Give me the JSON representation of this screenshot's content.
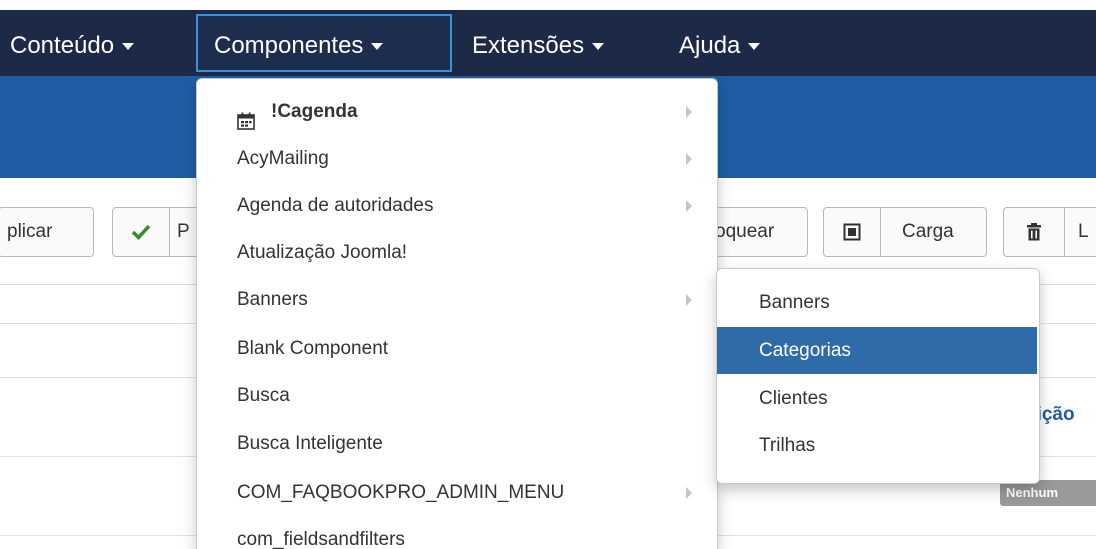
{
  "nav": {
    "items": [
      {
        "label": "Conteúdo",
        "active": false
      },
      {
        "label": "Componentes",
        "active": true
      },
      {
        "label": "Extensões",
        "active": false
      },
      {
        "label": "Ajuda",
        "active": false
      }
    ]
  },
  "toolbar": {
    "aplicar_fragment": "plicar",
    "publish_fragment": "P",
    "bloquear_fragment": "oquear",
    "carga_label": "Carga",
    "lixeira_fragment": "L"
  },
  "background": {
    "column_fragment": "sição",
    "status_badge": "Nenhum"
  },
  "components_menu": {
    "items": [
      {
        "label": "!Cagenda",
        "icon": "calendar-icon",
        "submenu": true
      },
      {
        "label": "AcyMailing",
        "submenu": true
      },
      {
        "label": "Agenda de autoridades",
        "submenu": true
      },
      {
        "label": "Atualização Joomla!",
        "submenu": false
      },
      {
        "label": "Banners",
        "submenu": true
      },
      {
        "label": "Blank Component",
        "submenu": false
      },
      {
        "label": "Busca",
        "submenu": false
      },
      {
        "label": "Busca Inteligente",
        "submenu": false
      },
      {
        "label": "COM_FAQBOOKPRO_ADMIN_MENU",
        "submenu": true
      },
      {
        "label": "com_fieldsandfilters",
        "submenu": false
      }
    ]
  },
  "banners_submenu": {
    "items": [
      {
        "label": "Banners",
        "active": false
      },
      {
        "label": "Categorias",
        "active": true
      },
      {
        "label": "Clientes",
        "active": false
      },
      {
        "label": "Trilhas",
        "active": false
      }
    ]
  },
  "colors": {
    "navbar": "#1c2a47",
    "subheader": "#1f5ca3",
    "highlight": "#2f6ba8",
    "active_outline": "#3c8fd9",
    "publish_check": "#3a8b2a"
  }
}
